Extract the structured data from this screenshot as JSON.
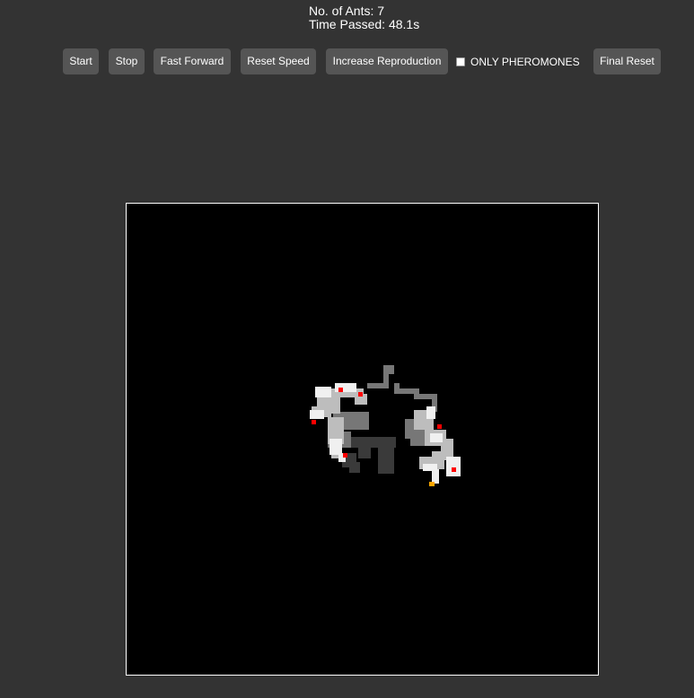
{
  "stats": {
    "ants_label": "No. of Ants: 7",
    "time_label": "Time Passed: 48.1s"
  },
  "toolbar": {
    "start_label": "Start",
    "stop_label": "Stop",
    "fast_forward_label": "Fast Forward",
    "reset_speed_label": "Reset Speed",
    "increase_reproduction_label": "Increase Reproduction",
    "only_pheromones_label": "ONLY PHEROMONES",
    "only_pheromones_checked": false,
    "final_reset_label": "Final Reset"
  },
  "simulation": {
    "background_color": "#000000",
    "border_color": "#ffffff",
    "ant_color": "#ff0000",
    "food_color": "#ffa500",
    "ant_count": 7
  }
}
